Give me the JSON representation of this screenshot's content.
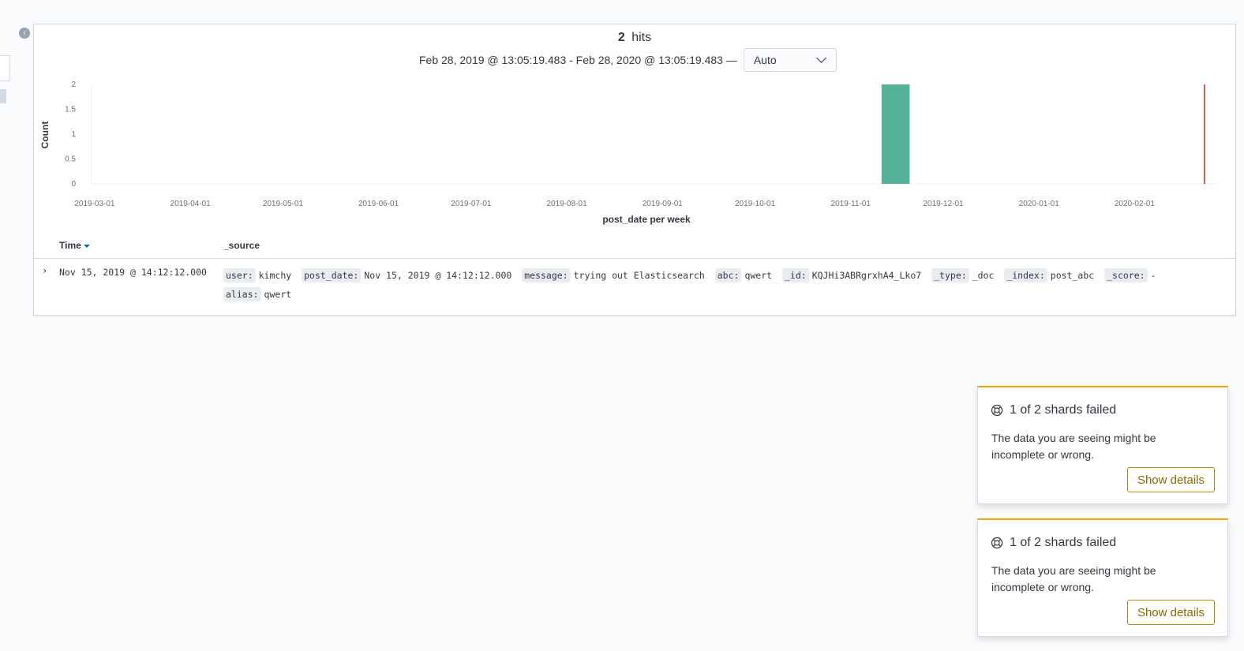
{
  "sidebar": {
    "collapse_icon": "chevron-left-icon"
  },
  "header": {
    "hits_count": "2",
    "hits_label": "hits",
    "time_range": "Feb 28, 2019 @ 13:05:19.483 - Feb 28, 2020 @ 13:05:19.483 —",
    "interval_value": "Auto"
  },
  "chart_data": {
    "type": "bar",
    "xlabel": "post_date per week",
    "ylabel": "Count",
    "yticks": [
      "0",
      "0.5",
      "1",
      "1.5",
      "2"
    ],
    "ylim": [
      0,
      2
    ],
    "xticks": [
      "2019-03-01",
      "2019-04-01",
      "2019-05-01",
      "2019-06-01",
      "2019-07-01",
      "2019-08-01",
      "2019-09-01",
      "2019-10-01",
      "2019-11-01",
      "2019-12-01",
      "2020-01-01",
      "2020-02-01"
    ],
    "x_range": [
      "2019-02-28",
      "2020-02-28"
    ],
    "bars": [
      {
        "week_start": "2019-11-11",
        "value": 2
      }
    ],
    "current_time_marker": "2020-02-28",
    "bar_color": "#54b399",
    "marker_color": "#bd271e"
  },
  "table": {
    "col_time": "Time",
    "col_source": "_source",
    "rows": [
      {
        "time": "Nov 15, 2019 @ 14:12:12.000",
        "fields": [
          {
            "key": "user:",
            "value": "kimchy"
          },
          {
            "key": "post_date:",
            "value": "Nov 15, 2019 @ 14:12:12.000"
          },
          {
            "key": "message:",
            "value": "trying out Elasticsearch"
          },
          {
            "key": "abc:",
            "value": "qwert"
          },
          {
            "key": "_id:",
            "value": "KQJHi3ABRgrxhA4_Lko7"
          },
          {
            "key": "_type:",
            "value": "_doc"
          },
          {
            "key": "_index:",
            "value": "post_abc"
          },
          {
            "key": "_score:",
            "value": "-"
          },
          {
            "key": "alias:",
            "value": "qwert"
          }
        ]
      }
    ]
  },
  "toasts": [
    {
      "title": "1 of 2 shards failed",
      "body": "The data you are seeing might be incomplete or wrong.",
      "button": "Show details",
      "icon": "help-icon"
    },
    {
      "title": "1 of 2 shards failed",
      "body": "The data you are seeing might be incomplete or wrong.",
      "button": "Show details",
      "icon": "help-icon"
    }
  ],
  "colors": {
    "accent_warning": "#f5a700",
    "link": "#006bb4"
  }
}
